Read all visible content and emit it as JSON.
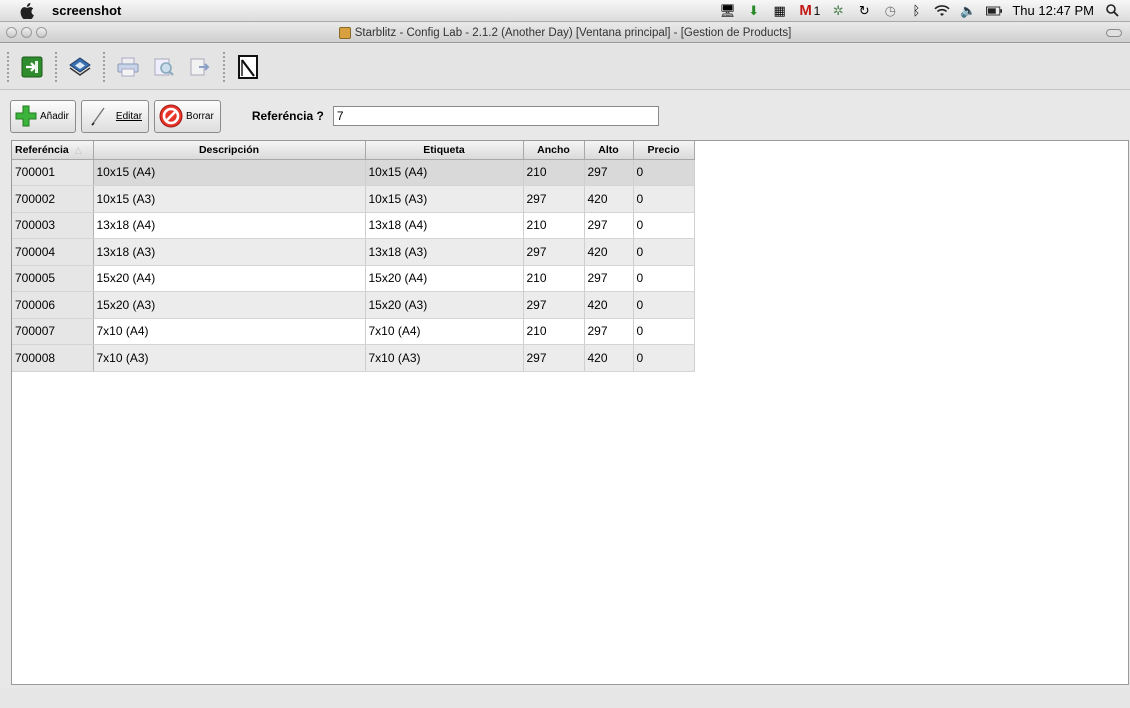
{
  "menubar": {
    "app_name": "screenshot",
    "gmail_count": "1",
    "clock": "Thu 12:47 PM"
  },
  "window": {
    "title": "Starblitz - Config Lab - 2.1.2 (Another Day) [Ventana principal] - [Gestion de Products]"
  },
  "actions": {
    "add_label": "Añadir",
    "edit_label": "Editar",
    "delete_label": "Borrar",
    "ref_label": "Referéncia ?",
    "ref_value": "7"
  },
  "table": {
    "headers": [
      "Referéncia",
      "Descripción",
      "Etiqueta",
      "Ancho",
      "Alto",
      "Precio"
    ],
    "rows": [
      [
        "700001",
        "10x15 (A4)",
        "10x15 (A4)",
        "210",
        "297",
        "0"
      ],
      [
        "700002",
        "10x15 (A3)",
        "10x15 (A3)",
        "297",
        "420",
        "0"
      ],
      [
        "700003",
        "13x18 (A4)",
        "13x18 (A4)",
        "210",
        "297",
        "0"
      ],
      [
        "700004",
        "13x18 (A3)",
        "13x18 (A3)",
        "297",
        "420",
        "0"
      ],
      [
        "700005",
        "15x20 (A4)",
        "15x20 (A4)",
        "210",
        "297",
        "0"
      ],
      [
        "700006",
        "15x20 (A3)",
        "15x20 (A3)",
        "297",
        "420",
        "0"
      ],
      [
        "700007",
        "7x10 (A4)",
        "7x10 (A4)",
        "210",
        "297",
        "0"
      ],
      [
        "700008",
        "7x10 (A3)",
        "7x10 (A3)",
        "297",
        "420",
        "0"
      ]
    ]
  }
}
